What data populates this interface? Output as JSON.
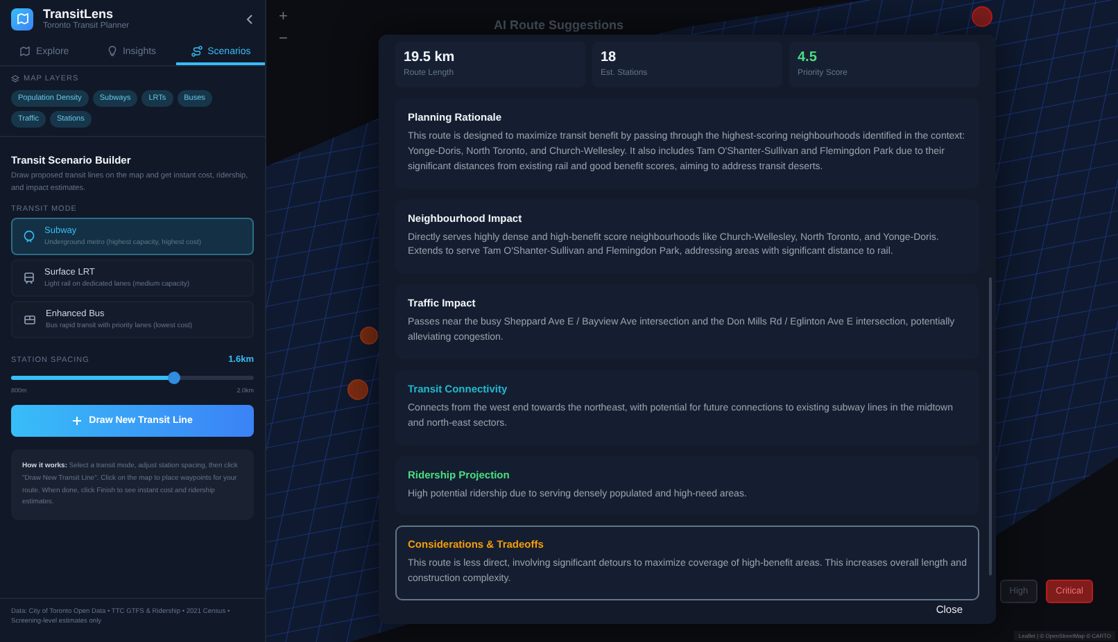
{
  "app": {
    "name": "TransitLens",
    "subtitle": "Toronto Transit Planner"
  },
  "tabs": [
    {
      "label": "Explore",
      "selected": false
    },
    {
      "label": "Insights",
      "selected": false
    },
    {
      "label": "Scenarios",
      "selected": true
    }
  ],
  "map_layers": {
    "heading": "MAP LAYERS",
    "chips": [
      "Population Density",
      "Subways",
      "LRTs",
      "Buses",
      "Traffic",
      "Stations"
    ]
  },
  "builder": {
    "title": "Transit Scenario Builder",
    "description": "Draw proposed transit lines on the map and get instant cost, ridership, and impact estimates.",
    "mode_heading": "TRANSIT MODE",
    "modes": [
      {
        "name": "Subway",
        "description": "Underground metro (highest capacity, highest cost)",
        "selected": true
      },
      {
        "name": "Surface LRT",
        "description": "Light rail on dedicated lanes (medium capacity)",
        "selected": false
      },
      {
        "name": "Enhanced Bus",
        "description": "Bus rapid transit with priority lanes (lowest cost)",
        "selected": false
      }
    ],
    "spacing": {
      "label": "STATION SPACING",
      "value": "1.6km",
      "level": 0.67,
      "min": "800m",
      "max": "2.0km"
    },
    "draw_button": "Draw New Transit Line",
    "how_it_works": "**How it works:** Select a transit mode, adjust station spacing, then click \"Draw New Transit Line\". Click on the map to place waypoints for your route. When done, click Finish to see instant cost and ridership estimates."
  },
  "footer": "Data: City of Toronto Open Data • TTC GTFS & Ridership • 2021 Census • Screening-level estimates only",
  "map": {
    "zoom_in": "+",
    "zoom_out": "−",
    "behind_title": "AI Route Suggestions",
    "legend": [
      {
        "label": "High",
        "selected": false
      },
      {
        "label": "Critical",
        "selected": true
      }
    ],
    "attribution": "Leaflet | © OpenStreetMap © CARTO"
  },
  "modal": {
    "stats": [
      {
        "value": "19.5 km",
        "label": "Route Length",
        "color": "#f1f5f9"
      },
      {
        "value": "18",
        "label": "Est. Stations",
        "color": "#f1f5f9"
      },
      {
        "value": "4.5",
        "label": "Priority Score",
        "color": "#4ade80"
      }
    ],
    "sections": [
      {
        "title": "Planning Rationale",
        "body": "This route is designed to maximize transit benefit by passing through the highest-scoring neighbourhoods identified in the context: Yonge-Doris, North Toronto, and Church-Wellesley. It also includes Tam O'Shanter-Sullivan and Flemingdon Park due to their significant distances from existing rail and good benefit scores, aiming to address transit deserts.",
        "color": "#f1f5f9"
      },
      {
        "title": "Neighbourhood Impact",
        "body": "Directly serves highly dense and high-benefit score neighbourhoods like Church-Wellesley, North Toronto, and Yonge-Doris. Extends to serve Tam O'Shanter-Sullivan and Flemingdon Park, addressing areas with significant distance to rail.",
        "color": "#f1f5f9"
      },
      {
        "title": "Traffic Impact",
        "body": "Passes near the busy Sheppard Ave E / Bayview Ave intersection and the Don Mills Rd / Eglinton Ave E intersection, potentially alleviating congestion.",
        "color": "#f1f5f9"
      },
      {
        "title": "Transit Connectivity",
        "body": "Connects from the west end towards the northeast, with potential for future connections to existing subway lines in the midtown and north-east sectors.",
        "color": "#22b8cf"
      },
      {
        "title": "Ridership Projection",
        "body": "High potential ridership due to serving densely populated and high-need areas.",
        "color": "#4ade80"
      },
      {
        "title": "Considerations & Tradeoffs",
        "body": "This route is less direct, involving significant detours to maximize coverage of high-benefit areas. This increases overall length and construction complexity.",
        "color": "#f59e0b",
        "outlined": true
      }
    ],
    "close": "Close"
  }
}
